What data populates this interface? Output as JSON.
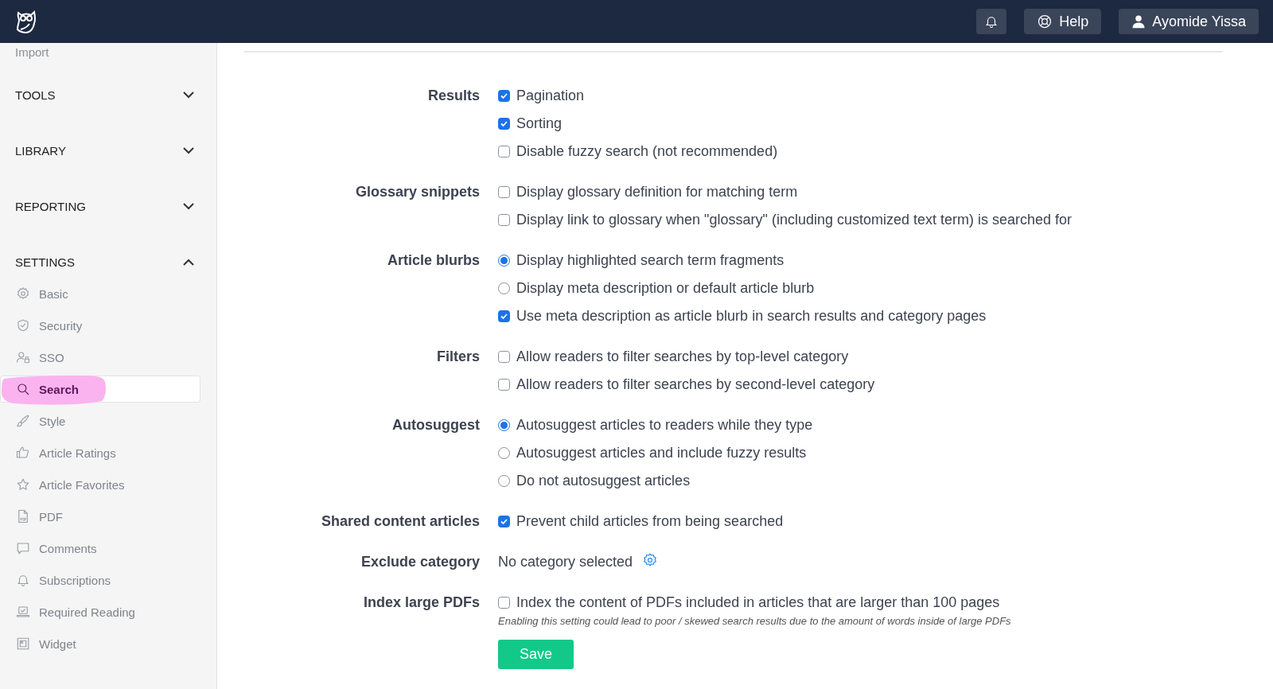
{
  "topbar": {
    "help": "Help",
    "user": "Ayomide Yissa"
  },
  "sidebar": {
    "top_item": "Import",
    "sections": [
      {
        "label": "TOOLS",
        "expanded": false
      },
      {
        "label": "LIBRARY",
        "expanded": false
      },
      {
        "label": "REPORTING",
        "expanded": false
      },
      {
        "label": "SETTINGS",
        "expanded": true,
        "items": [
          {
            "label": "Basic",
            "selected": false
          },
          {
            "label": "Security",
            "selected": false
          },
          {
            "label": "SSO",
            "selected": false
          },
          {
            "label": "Search",
            "selected": true
          },
          {
            "label": "Style",
            "selected": false
          },
          {
            "label": "Article Ratings",
            "selected": false
          },
          {
            "label": "Article Favorites",
            "selected": false
          },
          {
            "label": "PDF",
            "selected": false
          },
          {
            "label": "Comments",
            "selected": false
          },
          {
            "label": "Subscriptions",
            "selected": false
          },
          {
            "label": "Required Reading",
            "selected": false
          },
          {
            "label": "Widget",
            "selected": false
          }
        ]
      }
    ]
  },
  "settings": [
    {
      "label": "Results",
      "kind": "options",
      "options": [
        {
          "kind": "checkbox",
          "label": "Pagination",
          "checked": true
        },
        {
          "kind": "checkbox",
          "label": "Sorting",
          "checked": true
        },
        {
          "kind": "checkbox",
          "label": "Disable fuzzy search (not recommended)",
          "checked": false
        }
      ]
    },
    {
      "label": "Glossary snippets",
      "kind": "options",
      "options": [
        {
          "kind": "checkbox",
          "label": "Display glossary definition for matching term",
          "checked": false
        },
        {
          "kind": "checkbox",
          "label": "Display link to glossary when \"glossary\" (including customized text term) is searched for",
          "checked": false
        }
      ]
    },
    {
      "label": "Article blurbs",
      "kind": "options",
      "options": [
        {
          "kind": "radio",
          "label": "Display highlighted search term fragments",
          "selected": true
        },
        {
          "kind": "radio",
          "label": "Display meta description or default article blurb",
          "selected": false
        },
        {
          "kind": "checkbox",
          "label": "Use meta description as article blurb in search results and category pages",
          "checked": true
        }
      ]
    },
    {
      "label": "Filters",
      "kind": "options",
      "options": [
        {
          "kind": "checkbox",
          "label": "Allow readers to filter searches by top-level category",
          "checked": false
        },
        {
          "kind": "checkbox",
          "label": "Allow readers to filter searches by second-level category",
          "checked": false
        }
      ]
    },
    {
      "label": "Autosuggest",
      "kind": "options",
      "options": [
        {
          "kind": "radio",
          "label": "Autosuggest articles to readers while they type",
          "selected": true
        },
        {
          "kind": "radio",
          "label": "Autosuggest articles and include fuzzy results",
          "selected": false
        },
        {
          "kind": "radio",
          "label": "Do not autosuggest articles",
          "selected": false
        }
      ]
    },
    {
      "label": "Shared content articles",
      "kind": "options",
      "options": [
        {
          "kind": "checkbox",
          "label": "Prevent child articles from being searched",
          "checked": true
        }
      ]
    },
    {
      "label": "Exclude category",
      "kind": "picker",
      "value": "No category selected"
    },
    {
      "label": "Index large PDFs",
      "kind": "options",
      "options": [
        {
          "kind": "checkbox",
          "label": "Index the content of PDFs included in articles that are larger than 100 pages",
          "checked": false
        }
      ],
      "note": "Enabling this setting could lead to poor / skewed search results due to the amount of words inside of large PDFs"
    }
  ],
  "save": "Save"
}
